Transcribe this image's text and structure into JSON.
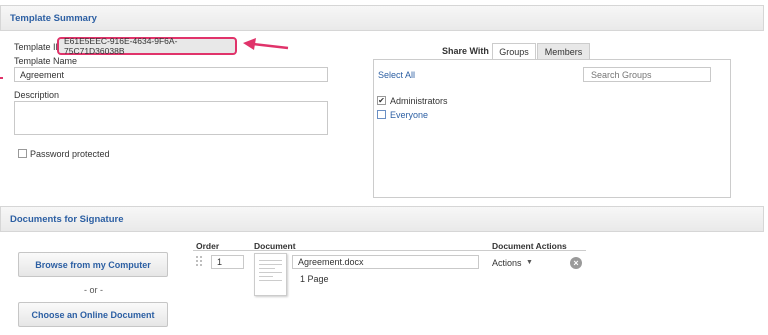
{
  "summary": {
    "header": "Template Summary",
    "template_id_label": "Template ID:",
    "template_id_value": "E61E5EEC-916E-4634-9F6A-75C71D36038B",
    "template_name_label": "Template Name",
    "template_name_value": "Agreement",
    "description_label": "Description",
    "description_value": "",
    "password_label": "Password protected",
    "password_checked": false
  },
  "share": {
    "label": "Share With",
    "tabs": [
      "Groups",
      "Members"
    ],
    "active_tab": "Groups",
    "select_all": "Select All",
    "search_placeholder": "Search Groups",
    "groups": [
      {
        "name": "Administrators",
        "checked": true
      },
      {
        "name": "Everyone",
        "checked": false
      }
    ]
  },
  "documents": {
    "header": "Documents for Signature",
    "browse_button": "Browse from my Computer",
    "or_text": "- or -",
    "online_button": "Choose an Online Document",
    "columns": [
      "Order",
      "Document",
      "Document Actions"
    ],
    "rows": [
      {
        "order": "1",
        "name": "Agreement.docx",
        "pages": "1 Page",
        "actions": "Actions"
      }
    ]
  },
  "colors": {
    "accent": "#2c5fa3",
    "highlight": "#e0336a"
  }
}
